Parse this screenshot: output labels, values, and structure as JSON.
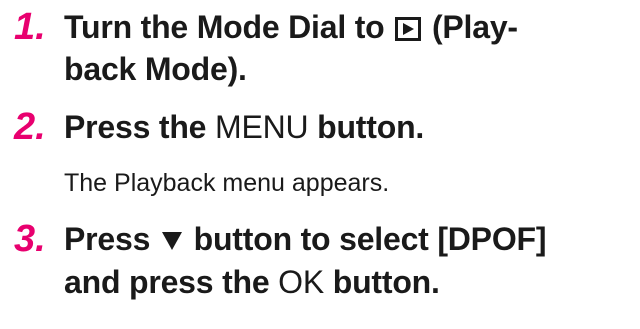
{
  "steps": [
    {
      "number": "1.",
      "line1_prefix": "Turn the Mode Dial to",
      "icon": "playback-icon",
      "line1_suffix": "(Play-",
      "line2": "back Mode)."
    },
    {
      "number": "2.",
      "prefix": "Press the",
      "menu_label": "MENU",
      "suffix": "button.",
      "note": "The Playback menu appears."
    },
    {
      "number": "3.",
      "line1_prefix": "Press",
      "icon": "down-triangle-icon",
      "line1_suffix": "button to select [DPOF]",
      "line2_prefix": "and press the",
      "ok_label": "OK",
      "line2_suffix": "button."
    }
  ],
  "colors": {
    "step_number": "#e8006f",
    "text": "#1a1a1a"
  }
}
